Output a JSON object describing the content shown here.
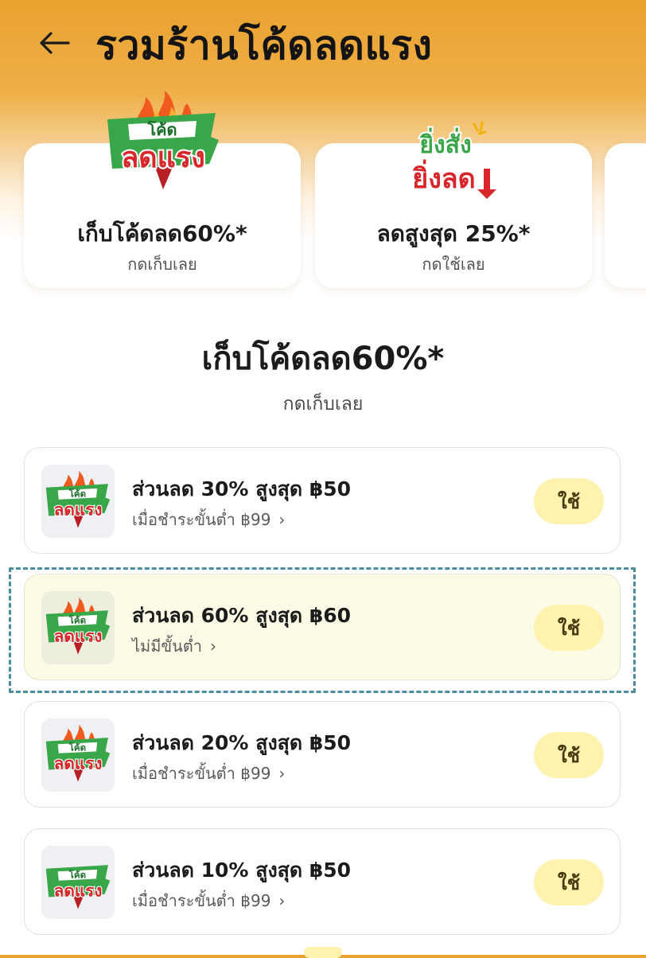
{
  "header": {
    "title": "รวมร้านโค้ดลดแรง",
    "back_icon": "arrow-left-icon"
  },
  "categories": [
    {
      "logo": "โค้ดลดแรง",
      "title": "เก็บโค้ดลด60%*",
      "subtitle": "กดเก็บเลย"
    },
    {
      "logo": "ยิ่งสั่งยิ่งลด",
      "title": "ลดสูงสุด 25%*",
      "subtitle": "กดใช้เลย"
    }
  ],
  "section": {
    "title": "เก็บโค้ดลด60%*",
    "subtitle": "กดเก็บเลย"
  },
  "vouchers": [
    {
      "title": "ส่วนลด 30% สูงสุด ฿50",
      "condition": "เมื่อชำระขั้นต่ำ ฿99",
      "button": "ใช้",
      "highlighted": false
    },
    {
      "title": "ส่วนลด 60% สูงสุด ฿60",
      "condition": "ไม่มีขั้นต่ำ",
      "button": "ใช้",
      "highlighted": true
    },
    {
      "title": "ส่วนลด 20% สูงสุด ฿50",
      "condition": "เมื่อชำระขั้นต่ำ ฿99",
      "button": "ใช้",
      "highlighted": false
    },
    {
      "title": "ส่วนลด 10% สูงสุด ฿50",
      "condition": "เมื่อชำระขั้นต่ำ ฿99",
      "button": "ใช้",
      "highlighted": false
    }
  ],
  "logo_texts": {
    "code_top": "โค้ด",
    "code_bottom": "ลดแรง",
    "more_top": "ยิ่งสั่ง",
    "more_bottom": "ยิ่งลด"
  },
  "colors": {
    "header_orange": "#e9a12e",
    "use_button_bg": "#fff1ae",
    "highlight_bg": "#fbfbe6",
    "highlight_border": "#4a8ea0",
    "logo_red": "#d8262b",
    "logo_green": "#3aa64a",
    "logo_flame": "#f05a1e"
  }
}
